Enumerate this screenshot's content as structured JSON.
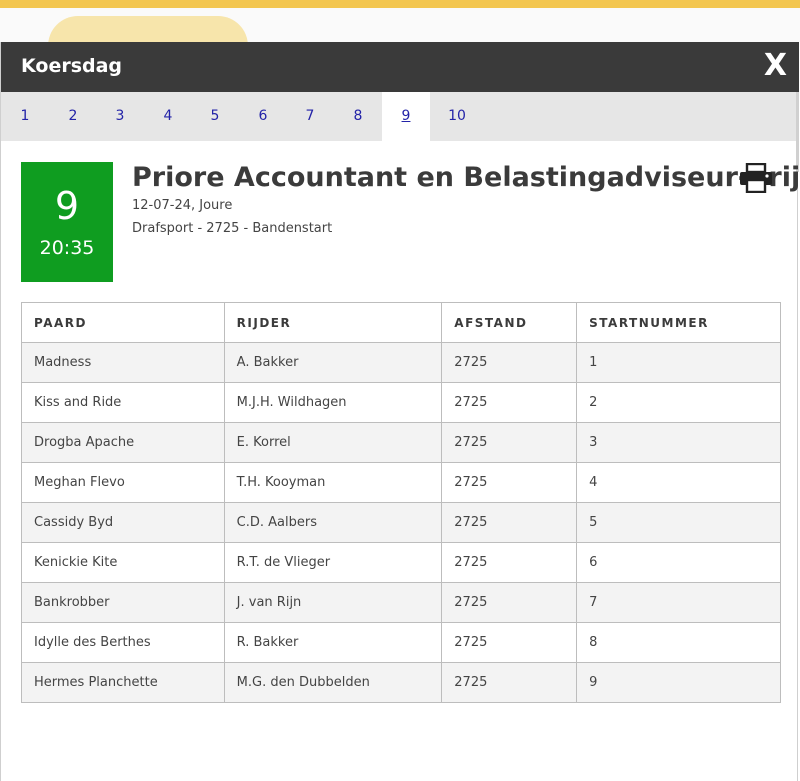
{
  "modal": {
    "title": "Koersdag",
    "close_label": "X"
  },
  "tabs": [
    {
      "label": "1"
    },
    {
      "label": "2"
    },
    {
      "label": "3"
    },
    {
      "label": "4"
    },
    {
      "label": "5"
    },
    {
      "label": "6"
    },
    {
      "label": "7"
    },
    {
      "label": "8"
    },
    {
      "label": "9",
      "active": true
    },
    {
      "label": "10"
    }
  ],
  "race": {
    "number": "9",
    "time": "20:35",
    "title": "Priore Accountant en Belastingadviseur-prijs",
    "date_location": "12-07-24, Joure",
    "details": "Drafsport - 2725 - Bandenstart",
    "badge_color": "#0f9d20"
  },
  "print_icon": "printer-icon",
  "table": {
    "headers": [
      "PAARD",
      "RIJDER",
      "AFSTAND",
      "STARTNUMMER"
    ],
    "rows": [
      [
        "Madness",
        "A. Bakker",
        "2725",
        "1"
      ],
      [
        "Kiss and Ride",
        "M.J.H. Wildhagen",
        "2725",
        "2"
      ],
      [
        "Drogba Apache",
        "E. Korrel",
        "2725",
        "3"
      ],
      [
        "Meghan Flevo",
        "T.H. Kooyman",
        "2725",
        "4"
      ],
      [
        "Cassidy Byd",
        "C.D. Aalbers",
        "2725",
        "5"
      ],
      [
        "Kenickie Kite",
        "R.T. de Vlieger",
        "2725",
        "6"
      ],
      [
        "Bankrobber",
        "J. van Rijn",
        "2725",
        "7"
      ],
      [
        "Idylle des Berthes",
        "R. Bakker",
        "2725",
        "8"
      ],
      [
        "Hermes Planchette",
        "M.G. den Dubbelden",
        "2725",
        "9"
      ]
    ]
  }
}
